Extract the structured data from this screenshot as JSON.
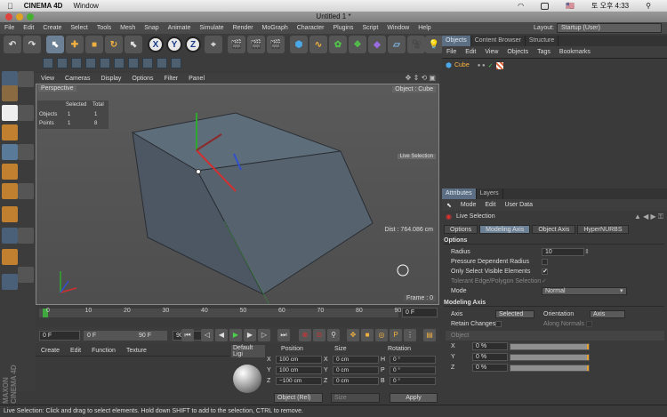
{
  "mac_menu": {
    "apple": "",
    "app": "CINEMA 4D",
    "window": "Window",
    "lang": "🇺🇸",
    "clock": "토 오후 4:33"
  },
  "window": {
    "title": "Untitled 1 *"
  },
  "app_menu": [
    "File",
    "Edit",
    "Create",
    "Select",
    "Tools",
    "Mesh",
    "Snap",
    "Animate",
    "Simulate",
    "Render",
    "MoGraph",
    "Character",
    "Plugins",
    "Script",
    "Window",
    "Help"
  ],
  "layout": {
    "label": "Layout:",
    "value": "Startup (User)"
  },
  "toolbar": {
    "x_axis": "X",
    "y_axis": "Y",
    "z_axis": "Z"
  },
  "viewport": {
    "menu": [
      "View",
      "Cameras",
      "Display",
      "Options",
      "Filter",
      "Panel"
    ],
    "perspective_label": "Perspective",
    "object_label": "Object : Cube",
    "live_selection_label": "Live Selection",
    "distance": "Dist : 764.086 cm",
    "frame": "Frame : 0",
    "info": {
      "header_selected": "Selected",
      "header_total": "Total",
      "objects_label": "Objects",
      "objects_selected": "1",
      "objects_total": "1",
      "points_label": "Points",
      "points_selected": "1",
      "points_total": "8"
    }
  },
  "timeline": {
    "ticks": [
      "0",
      "10",
      "20",
      "30",
      "40",
      "50",
      "60",
      "70",
      "80",
      "90"
    ],
    "end_field": "0 F"
  },
  "transport": {
    "current": "0 F",
    "min": "0 F",
    "range_end": "90 F",
    "max": "90 F"
  },
  "materials": {
    "menu": [
      "Create",
      "Edit",
      "Function",
      "Texture"
    ],
    "preview_name": "Default Ligi"
  },
  "coordinates": {
    "headers": {
      "position": "Position",
      "size": "Size",
      "rotation": "Rotation"
    },
    "rows": [
      {
        "axis": "X",
        "pos": "100 cm",
        "size_axis": "X",
        "size": "0 cm",
        "rot_axis": "H",
        "rot": "0 °"
      },
      {
        "axis": "Y",
        "pos": "100 cm",
        "size_axis": "Y",
        "size": "0 cm",
        "rot_axis": "P",
        "rot": "0 °"
      },
      {
        "axis": "Z",
        "pos": "−100 cm",
        "size_axis": "Z",
        "size": "0 cm",
        "rot_axis": "B",
        "rot": "0 °"
      }
    ],
    "mode": "Object (Rel)",
    "size_mode": "Size",
    "apply": "Apply"
  },
  "status": "Live Selection: Click and drag to select elements. Hold down SHIFT to add to the selection, CTRL to remove.",
  "objects_panel": {
    "tabs": [
      "Objects",
      "Content Browser",
      "Structure"
    ],
    "menu": [
      "File",
      "Edit",
      "View",
      "Objects",
      "Tags",
      "Bookmarks"
    ],
    "cube": "Cube"
  },
  "attributes_panel": {
    "tabs": [
      "Attributes",
      "Layers"
    ],
    "menu": [
      "Mode",
      "Edit",
      "User Data"
    ],
    "tool_name": "Live Selection",
    "subtabs": [
      "Options",
      "Modeling Axis",
      "Object Axis",
      "HyperNURBS"
    ],
    "options": {
      "title": "Options",
      "radius_label": "Radius",
      "radius_value": "10",
      "pressure_label": "Pressure Dependent Radius",
      "visible_label": "Only Select Visible Elements",
      "visible_check": "✔",
      "tolerant_label": "Tolerant Edge/Polygon Selection",
      "mode_label": "Mode",
      "mode_value": "Normal"
    },
    "modeling_axis": {
      "title": "Modeling Axis",
      "axis_label": "Axis",
      "axis_value": "Selected",
      "orientation_label": "Orientation",
      "orientation_value": "Axis",
      "retain_label": "Retain Changes",
      "along_normals_label": "Along Normals",
      "object_label": "Object",
      "x_label": "X",
      "x_value": "0 %",
      "y_label": "Y",
      "y_value": "0 %",
      "z_label": "Z",
      "z_value": "0 %"
    }
  },
  "brand": "MAXON CINEMA 4D",
  "colors": {
    "accent": "#5b6e84",
    "selection_orange": "#ffb340",
    "background": "#3a3a3a"
  }
}
